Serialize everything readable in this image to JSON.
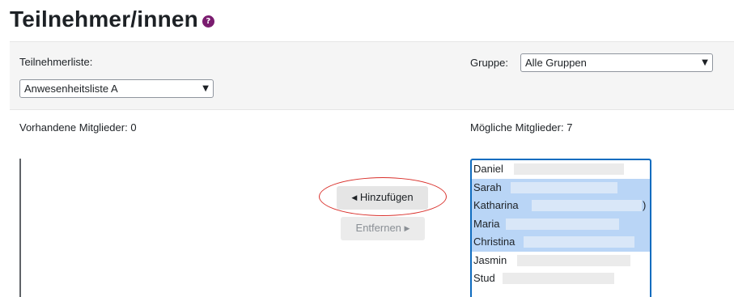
{
  "header": {
    "title": "Teilnehmer/innen",
    "help_glyph": "?"
  },
  "filters": {
    "participant_list_label": "Teilnehmerliste:",
    "participant_list_value": "Anwesenheitsliste A",
    "group_label": "Gruppe:",
    "group_value": "Alle Gruppen"
  },
  "existing": {
    "label": "Vorhandene Mitglieder: 0"
  },
  "possible": {
    "label": "Mögliche Mitglieder: 7",
    "members": [
      {
        "name": "Daniel",
        "selected": false,
        "suffix": ""
      },
      {
        "name": "Sarah",
        "selected": true,
        "suffix": ""
      },
      {
        "name": "Katharina",
        "selected": true,
        "suffix": ")"
      },
      {
        "name": "Maria",
        "selected": true,
        "suffix": ""
      },
      {
        "name": "Christina",
        "selected": true,
        "suffix": ""
      },
      {
        "name": "Jasmin",
        "selected": false,
        "suffix": ""
      },
      {
        "name": "Stud",
        "selected": false,
        "suffix": ""
      }
    ]
  },
  "actions": {
    "add_label": "Hinzufügen",
    "remove_label": "Entfernen"
  },
  "icons": {
    "help": "help-icon",
    "add_arrow": "arrow-left-icon",
    "remove_arrow": "arrow-right-icon",
    "dropdown": "chevron-down-icon"
  },
  "colors": {
    "help_icon": "#7a1c6f",
    "selection": "#b9d5f6",
    "focus_border": "#0f6cbf",
    "annotation": "#d9302b"
  }
}
